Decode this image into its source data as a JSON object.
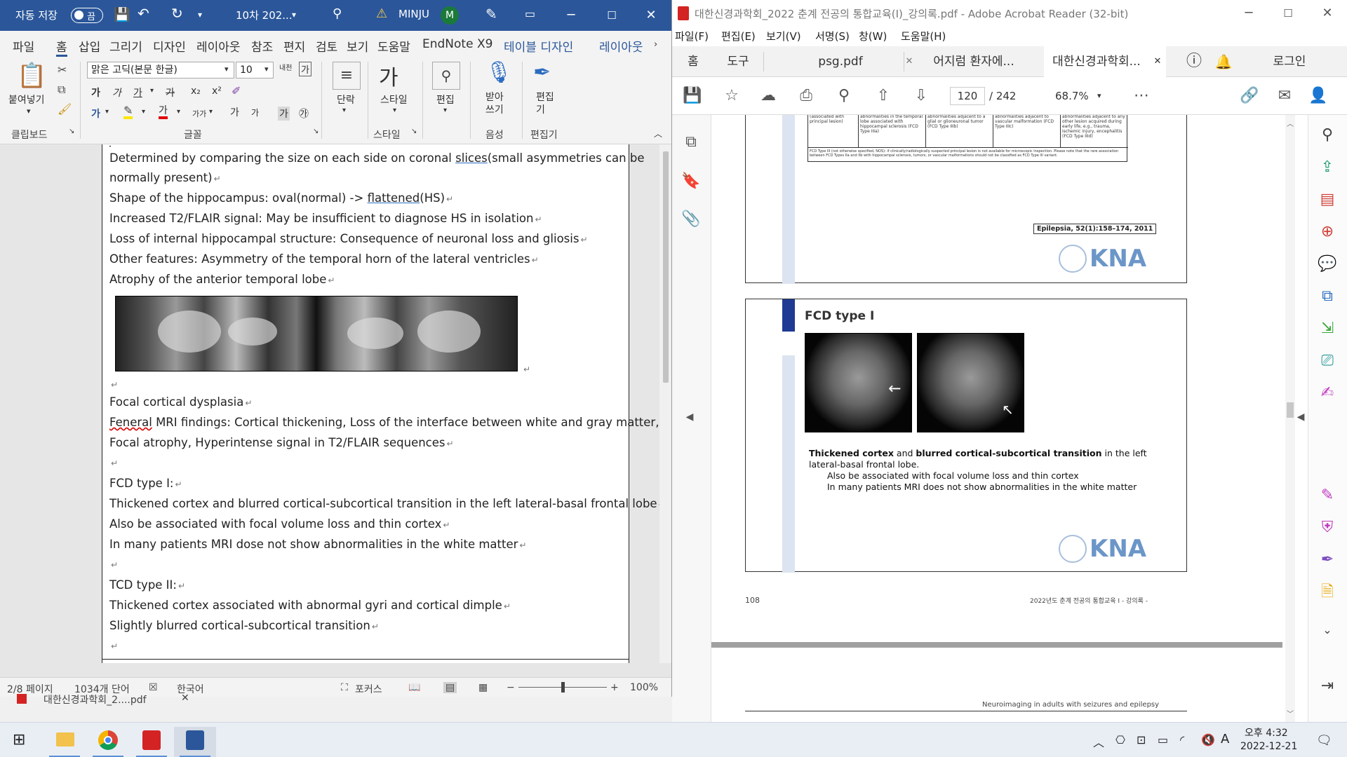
{
  "word": {
    "title": {
      "autosave_label": "자동 저장",
      "toggle_state": "끔",
      "doc_name": "10차 202...",
      "user_name": "MINJU",
      "user_initial": "M"
    },
    "menu": [
      "파일",
      "홈",
      "삽입",
      "그리기",
      "디자인",
      "레이아웃",
      "참조",
      "편지",
      "검토",
      "보기",
      "도움말",
      "EndNote X9",
      "테이블 디자인",
      "레이아웃"
    ],
    "ribbon": {
      "paste_label": "붙여넣기",
      "clipboard_label": "클립보드",
      "font_name": "맑은 고딕(본문 한글)",
      "font_size": "10",
      "font_group_label": "글꼴",
      "paragraph_label": "단락",
      "styles_button": "스타일",
      "styles_group_label": "스타일",
      "editing_label": "편집",
      "dictate_label": "받아쓰기",
      "voice_group_label": "음성",
      "editor_label": "편집기",
      "editor_group_label": "편집기",
      "font_buttons": [
        "가",
        "가",
        "가",
        "가",
        "x₂",
        "x²",
        "가"
      ],
      "grow_font": "가",
      "shrink_font": "가",
      "char_shading": "가",
      "char_border": "㉮",
      "char_spacing": "가가",
      "new_line": "내천"
    },
    "document": {
      "lines": [
        "Determined by comparing the size on each side on coronal ",
        "normally present)",
        "Shape of the hippocampus: oval(normal) -> ",
        "Increased T2/FLAIR signal: May be insufficient to diagnose HS in isolation",
        "Loss of internal hippocampal structure: Consequence of neuronal loss and gliosis",
        "Other features: Asymmetry of the temporal horn of the lateral ventricles",
        "Atrophy of the anterior temporal lobe"
      ],
      "slices_word": "slices",
      "after_slices": "(small asymmetries can be",
      "flattened_word": "flattened",
      "after_flattened": "(HS)",
      "fcd_heading": "Focal cortical dysplasia",
      "general_misspelled": "Feneral",
      "general_rest": " MRI findings: Cortical thickening, Loss of the interface between white and gray matter,",
      "general_line2": "Focal atrophy, Hyperintense signal in T2/FLAIR sequences",
      "fcd1_title": "FCD type I:",
      "fcd1_lines": [
        "Thickened cortex and blurred cortical-subcortical transition in the left lateral-basal frontal lobe",
        "Also be associated with focal volume loss and thin cortex",
        "In many patients MRI dose not show abnormalities in the white matter"
      ],
      "tcd2_title": "TCD type II:",
      "tcd2_lines": [
        "Thickened cortex associated with abnormal gyri and cortical dimple",
        "Slightly blurred cortical-subcortical transition"
      ],
      "paragraph_mark": "↵"
    },
    "status": {
      "page": "2/8 페이지",
      "words": "1034개 단어",
      "language": "한국어",
      "focus": "포커스",
      "zoom": "100%",
      "zoom_minus": "−",
      "zoom_plus": "+"
    },
    "hidden_tab": "대한신경과학회_2....pdf"
  },
  "acrobat": {
    "title": "대한신경과학회_2022 춘계 전공의 통합교육(I)_강의록.pdf - Adobe Acrobat Reader (32-bit)",
    "menu": [
      "파일(F)",
      "편집(E)",
      "보기(V)",
      "서명(S)",
      "창(W)",
      "도움말(H)"
    ],
    "tabs": {
      "home": "홈",
      "tools": "도구",
      "docs": [
        "psg.pdf",
        "어지럼 환자에...",
        "대한신경과학회..."
      ],
      "login": "로그인"
    },
    "toolbar": {
      "current_page": "120",
      "total_pages": "/  242",
      "zoom": "68.7%"
    },
    "slide1": {
      "table_cells": [
        "FCD Type III (associated with principal lesion)",
        "Cortical lamination abnormalities in the temporal lobe associated with hippocampal sclerosis (FCD Type IIIa)",
        "Cortical lamination abnormalities adjacent to a glial or glioneuronal tumor (FCD Type IIIb)",
        "Cortical lamination abnormalities adjacent to vascular malformation (FCD Type IIIc)",
        "Cortical lamination abnormalities adjacent to any other lesion acquired during early life, e.g., trauma, ischemic injury, encephalitis (FCD Type IIId)"
      ],
      "table_foot": "FCD Type III (not otherwise specified, NOS): if clinically/radiologically suspected principal lesion is not available for microscopic inspection. Please note that the rare association between FCD Types IIa and IIb with hippocampal sclerosis, tumors, or vascular malformations should not be classified as FCD Type III variant.",
      "citation": "Epilepsia, 52(1):158–174, 2011",
      "logo": "KNA"
    },
    "slide2": {
      "title": "FCD type I",
      "caption_bold1": "Thickened cortex",
      "caption_mid": " and ",
      "caption_bold2": "blurred cortical-subcortical transition",
      "caption_rest": " in the left",
      "caption_line2": "lateral-basal frontal lobe.",
      "bullet1": "Also be associated with focal volume loss and thin cortex",
      "bullet2": "In many patients MRI does not show abnormalities in the white matter",
      "logo": "KNA"
    },
    "page_footer": {
      "number": "108",
      "right": "2022년도 춘계 전공의 통합교육 I  -  강의록  -",
      "next_header": "Neuroimaging in adults with seizures and epilepsy"
    }
  },
  "taskbar": {
    "time": "오후 4:32",
    "date": "2022-12-21",
    "ime": "A"
  },
  "colors": {
    "word_blue": "#2b579a",
    "kna_blue": "#6b96c8",
    "slide_bar": "#1f3a93"
  }
}
